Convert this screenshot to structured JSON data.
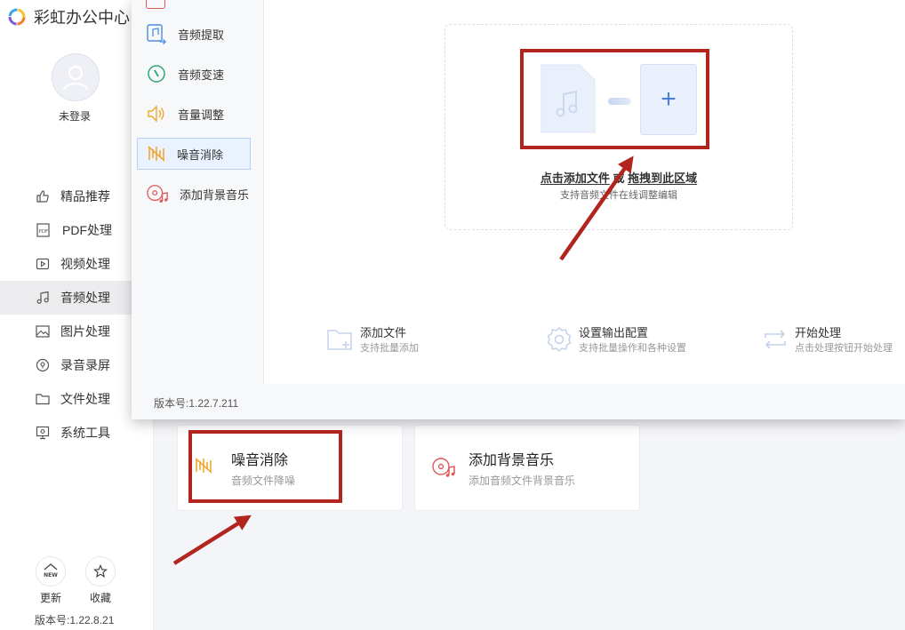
{
  "app": {
    "title": "彩虹办公中心",
    "login_label": "未登录",
    "nav": [
      {
        "label": "精品推荐",
        "icon": "thumbs-up-icon",
        "active": false
      },
      {
        "label": "PDF处理",
        "icon": "pdf-icon",
        "active": false
      },
      {
        "label": "视频处理",
        "icon": "video-icon",
        "active": false
      },
      {
        "label": "音频处理",
        "icon": "music-note-icon",
        "active": true
      },
      {
        "label": "图片处理",
        "icon": "image-icon",
        "active": false
      },
      {
        "label": "录音录屏",
        "icon": "record-icon",
        "active": false
      },
      {
        "label": "文件处理",
        "icon": "folder-icon",
        "active": false
      },
      {
        "label": "系统工具",
        "icon": "monitor-icon",
        "active": false
      }
    ],
    "footer": {
      "update_label": "更新",
      "update_badge": "NEW",
      "favorite_label": "收藏",
      "version": "版本号:1.22.8.21"
    },
    "cards": [
      {
        "title": "噪音消除",
        "desc": "音频文件降噪",
        "icon": "noise-removal-icon"
      },
      {
        "title": "添加背景音乐",
        "desc": "添加音频文件背景音乐",
        "icon": "background-music-icon"
      }
    ]
  },
  "tool_window": {
    "tools": [
      {
        "label": "音频提取",
        "icon": "audio-extract-icon",
        "active": false
      },
      {
        "label": "音频变速",
        "icon": "speed-icon",
        "active": false
      },
      {
        "label": "音量调整",
        "icon": "volume-icon",
        "active": false
      },
      {
        "label": "噪音消除",
        "icon": "noise-removal-icon",
        "active": true
      },
      {
        "label": "添加背景音乐",
        "icon": "background-music-icon",
        "active": false
      }
    ],
    "drop": {
      "add_file_text": "点击添加文件",
      "or_text": "或",
      "drag_text": "拖拽到此区域",
      "sub": "支持音频文件在线调整编辑"
    },
    "steps": [
      {
        "title": "添加文件",
        "desc": "支持批量添加",
        "icon": "add-folder-icon"
      },
      {
        "title": "设置输出配置",
        "desc": "支持批量操作和各种设置",
        "icon": "gear-icon"
      },
      {
        "title": "开始处理",
        "desc": "点击处理按钮开始处理",
        "icon": "repeat-icon"
      }
    ],
    "version": "版本号:1.22.7.211"
  },
  "colors": {
    "annotation": "#b2241e",
    "accent": "#4a7fd6",
    "noise_icon": "#f0a830",
    "bgm_icon": "#e05a5a"
  }
}
